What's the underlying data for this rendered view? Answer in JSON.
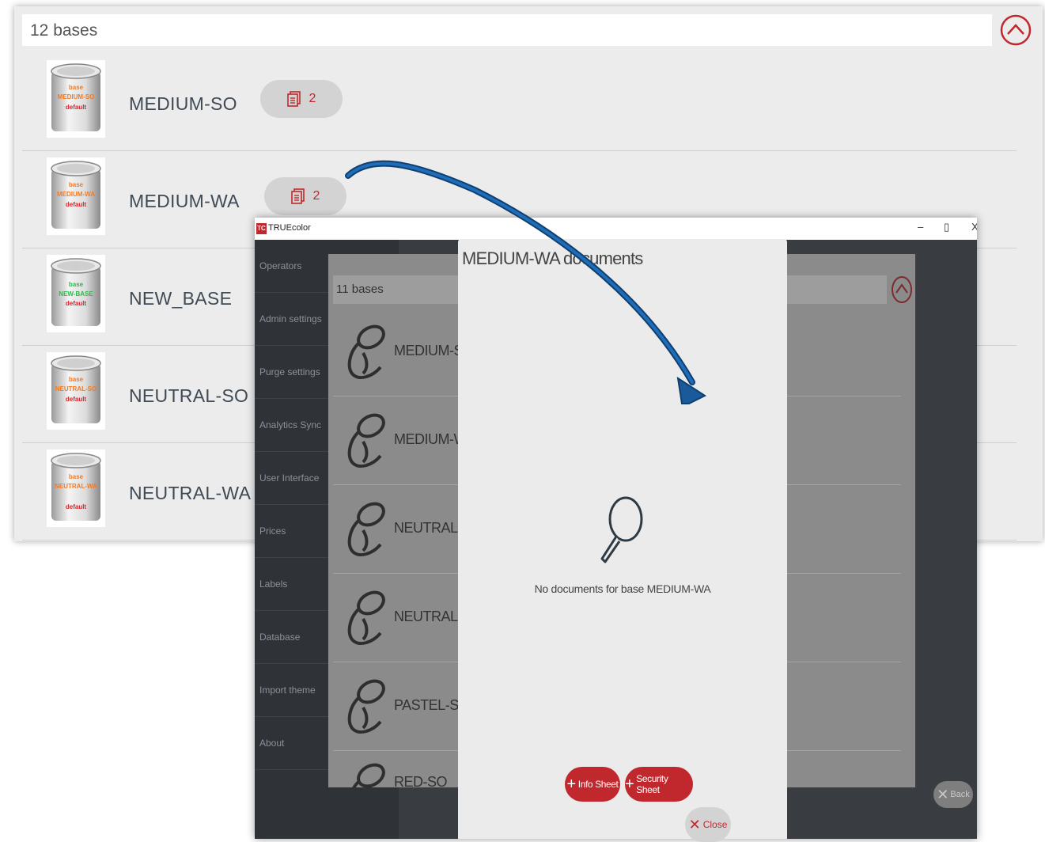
{
  "background_panel": {
    "count_label": "12 bases",
    "rows": [
      {
        "name": "MEDIUM-SO",
        "can_line1": "base",
        "can_line2": "MEDIUM-SO",
        "can_line3": "default",
        "label_color": "#f47a21",
        "doc_count": "2"
      },
      {
        "name": "MEDIUM-WA",
        "can_line1": "base",
        "can_line2": "MEDIUM-WA",
        "can_line3": "default",
        "label_color": "#f47a21",
        "doc_count": "2"
      },
      {
        "name": "NEW_BASE",
        "can_line1": "base",
        "can_line2": "NEW-BASE",
        "can_line3": "default",
        "label_color": "#2db84a",
        "doc_count": ""
      },
      {
        "name": "NEUTRAL-SO",
        "can_line1": "base",
        "can_line2": "NEUTRAL-SO",
        "can_line3": "default",
        "label_color": "#f47a21",
        "doc_count": ""
      },
      {
        "name": "NEUTRAL-WA",
        "can_line1": "base",
        "can_line2": "NEUTRAL-WA",
        "can_line3": "default",
        "label_color": "#f47a21",
        "doc_count": ""
      }
    ]
  },
  "window": {
    "title": "TRUEcolor",
    "logo": "TC",
    "controls": {
      "minimize": "–",
      "restore": "▯",
      "close": "X"
    },
    "sidebar": [
      "Operators",
      "Admin settings",
      "Purge settings",
      "Analytics Sync",
      "User Interface",
      "Prices",
      "Labels",
      "Database",
      "Import theme",
      "About"
    ],
    "inner_count_label": "11 bases",
    "inner_rows": [
      "MEDIUM-SO",
      "MEDIUM-WA",
      "NEUTRAL-SO",
      "NEUTRAL-WA",
      "PASTEL-SO",
      "RED-SO"
    ],
    "back_label": "Back"
  },
  "dialog": {
    "title": "MEDIUM-WA documents",
    "empty_message": "No documents for base MEDIUM-WA",
    "info_sheet_label": "Info Sheet",
    "security_sheet_label": "Security Sheet",
    "close_label": "Close"
  },
  "colors": {
    "accent_red": "#c0282d",
    "arrow_blue": "#1a5a9a",
    "can_red_text": "#d9252b"
  },
  "icons": [
    "chevron-up-icon",
    "document-icon",
    "paint-can-icon",
    "search-icon",
    "plus-icon",
    "close-x-icon",
    "arrow-icon"
  ]
}
